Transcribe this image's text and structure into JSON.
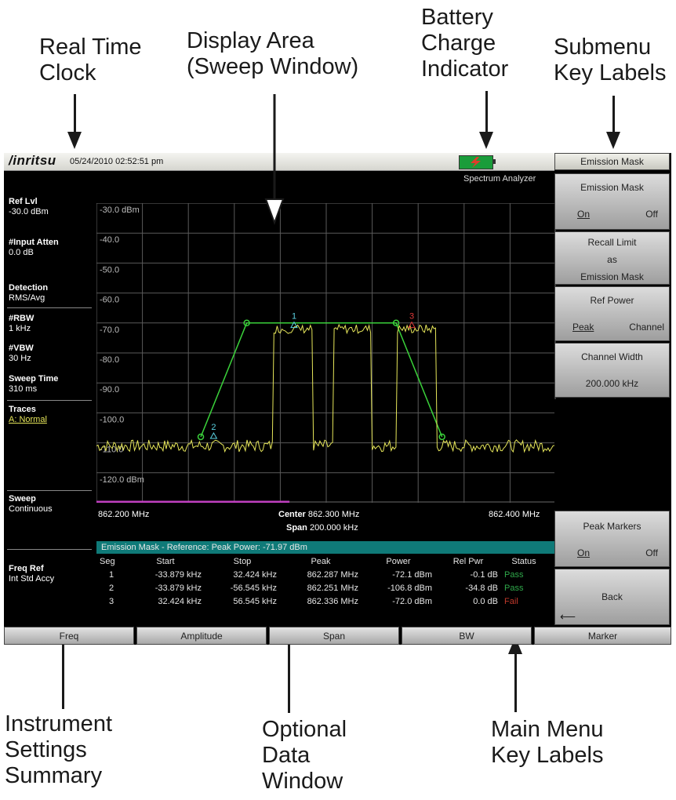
{
  "callouts": {
    "clock": [
      "Real Time",
      "Clock"
    ],
    "display": [
      "Display Area",
      "(Sweep Window)"
    ],
    "battery": [
      "Battery",
      "Charge",
      "Indicator"
    ],
    "submenu": [
      "Submenu",
      "Key Labels"
    ],
    "settings": [
      "Instrument",
      "Settings",
      "Summary"
    ],
    "data": [
      "Optional",
      "Data",
      "Window"
    ],
    "mainmenu": [
      "Main Menu",
      "Key Labels"
    ]
  },
  "screen": {
    "logo": "/inritsu",
    "datetime": "05/24/2010 02:52:51 pm",
    "mode": "Spectrum Analyzer",
    "battery_color": "#1a9c3a"
  },
  "settings_summary": {
    "ref_lvl_label": "Ref Lvl",
    "ref_lvl": "-30.0 dBm",
    "atten_label": "#Input Atten",
    "atten": "0.0 dB",
    "detection_label": "Detection",
    "detection": "RMS/Avg",
    "rbw_label": "#RBW",
    "rbw": "1 kHz",
    "vbw_label": "#VBW",
    "vbw": "30 Hz",
    "sweep_time_label": "Sweep Time",
    "sweep_time": "310 ms",
    "traces_label": "Traces",
    "traces": "A: Normal",
    "sweep_label": "Sweep",
    "sweep": "Continuous",
    "freq_ref_label": "Freq Ref",
    "freq_ref": "Int Std Accy"
  },
  "plot": {
    "y_labels": [
      "-30.0 dBm",
      "-40.0",
      "-50.0",
      "-60.0",
      "-70.0",
      "-80.0",
      "-90.0",
      "-100.0",
      "-110.0",
      "-120.0 dBm"
    ],
    "start_freq": "862.200 MHz",
    "center_label": "Center",
    "center_freq": "862.300 MHz",
    "span_label": "Span",
    "span": "200.000 kHz",
    "stop_freq": "862.400 MHz",
    "markers": [
      "1",
      "2",
      "3"
    ],
    "colors": {
      "trace": "#e6e65a",
      "mask": "#3ad13a",
      "grid": "#5a5a5a",
      "marker1": "#5ad0e0",
      "marker3": "#e03a3a"
    }
  },
  "data_window": {
    "title": "Emission Mask - Reference: Peak Power: -71.97 dBm",
    "headers": [
      "Seg",
      "Start",
      "Stop",
      "Peak",
      "Power",
      "Rel Pwr",
      "Status"
    ],
    "rows": [
      [
        "1",
        "-33.879 kHz",
        "32.424 kHz",
        "862.287 MHz",
        "-72.1 dBm",
        "-0.1 dB",
        "Pass"
      ],
      [
        "2",
        "-33.879 kHz",
        "-56.545 kHz",
        "862.251 MHz",
        "-106.8 dBm",
        "-34.8 dB",
        "Pass"
      ],
      [
        "3",
        "32.424 kHz",
        "56.545 kHz",
        "862.336 MHz",
        "-72.0 dBm",
        "0.0 dB",
        "Fail"
      ]
    ],
    "status_colors": {
      "Pass": "#2fa84a",
      "Fail": "#c0392b"
    }
  },
  "submenu": {
    "title": "Emission Mask",
    "k1_label": "Emission Mask",
    "k1_on": "On",
    "k1_off": "Off",
    "k2_l1": "Recall Limit",
    "k2_l2": "as",
    "k2_l3": "Emission Mask",
    "k3_label": "Ref Power",
    "k3_on": "Peak",
    "k3_off": "Channel",
    "k4_label": "Channel Width",
    "k4_value": "200.000 kHz",
    "k5_label": "Peak Markers",
    "k5_on": "On",
    "k5_off": "Off",
    "k6_label": "Back"
  },
  "main_menu": [
    "Freq",
    "Amplitude",
    "Span",
    "BW",
    "Marker"
  ]
}
